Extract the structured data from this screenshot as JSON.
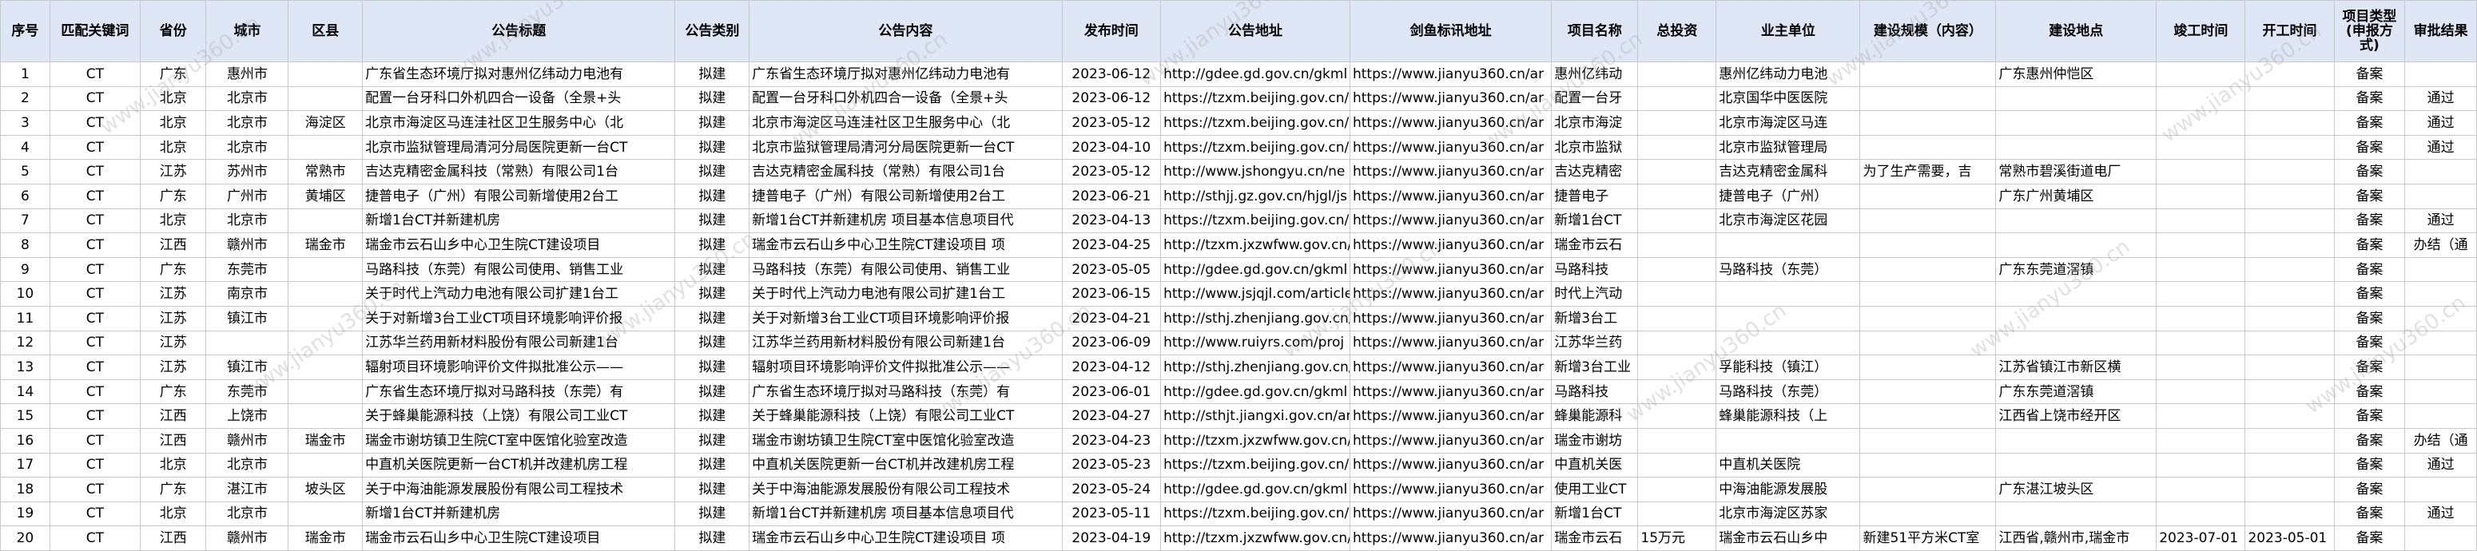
{
  "headers": [
    "序号",
    "匹配关键词",
    "省份",
    "城市",
    "区县",
    "公告标题",
    "公告类别",
    "公告内容",
    "发布时间",
    "公告地址",
    "剑鱼标讯地址",
    "项目名称",
    "总投资",
    "业主单位",
    "建设规模（内容）",
    "建设地点",
    "竣工时间",
    "开工时间",
    "项目类型(申报方式)",
    "审批结果"
  ],
  "rows": [
    [
      "1",
      "CT",
      "广东",
      "惠州市",
      "",
      "广东省生态环境厅拟对惠州亿纬动力电池有",
      "拟建",
      "广东省生态环境厅拟对惠州亿纬动力电池有",
      "2023-06-12",
      "http://gdee.gd.gov.cn/gkml",
      "https://www.jianyu360.cn/ar",
      "惠州亿纬动",
      "",
      "惠州亿纬动力电池",
      "",
      "广东惠州仲恺区",
      "",
      "",
      "备案",
      ""
    ],
    [
      "2",
      "CT",
      "北京",
      "北京市",
      "",
      "配置一台牙科口外机四合一设备（全景+头",
      "拟建",
      "配置一台牙科口外机四合一设备（全景+头",
      "2023-06-12",
      "https://tzxm.beijing.gov.cn/i",
      "https://www.jianyu360.cn/ar",
      "配置一台牙",
      "",
      "北京国华中医医院",
      "",
      "",
      "",
      "",
      "备案",
      "通过"
    ],
    [
      "3",
      "CT",
      "北京",
      "北京市",
      "海淀区",
      "北京市海淀区马连洼社区卫生服务中心（北",
      "拟建",
      "北京市海淀区马连洼社区卫生服务中心（北",
      "2023-05-12",
      "https://tzxm.beijing.gov.cn/i",
      "https://www.jianyu360.cn/ar",
      "北京市海淀",
      "",
      "北京市海淀区马连",
      "",
      "",
      "",
      "",
      "备案",
      "通过"
    ],
    [
      "4",
      "CT",
      "北京",
      "北京市",
      "",
      "北京市监狱管理局清河分局医院更新一台CT",
      "拟建",
      "北京市监狱管理局清河分局医院更新一台CT",
      "2023-04-10",
      "https://tzxm.beijing.gov.cn/i",
      "https://www.jianyu360.cn/ar",
      "北京市监狱",
      "",
      "北京市监狱管理局",
      "",
      "",
      "",
      "",
      "备案",
      "通过"
    ],
    [
      "5",
      "CT",
      "江苏",
      "苏州市",
      "常熟市",
      "吉达克精密金属科技（常熟）有限公司1台",
      "拟建",
      "吉达克精密金属科技（常熟）有限公司1台",
      "2023-05-12",
      "http://www.jshongyu.cn/ne",
      "https://www.jianyu360.cn/ar",
      "吉达克精密",
      "",
      "吉达克精密金属科",
      "为了生产需要，吉",
      "常熟市碧溪街道电厂",
      "",
      "",
      "备案",
      ""
    ],
    [
      "6",
      "CT",
      "广东",
      "广州市",
      "黄埔区",
      "捷普电子（广州）有限公司新增使用2台工",
      "拟建",
      "捷普电子（广州）有限公司新增使用2台工",
      "2023-06-21",
      "http://sthjj.gz.gov.cn/hjgl/js",
      "https://www.jianyu360.cn/ar",
      "捷普电子",
      "",
      "捷普电子（广州）",
      "",
      "广东广州黄埔区",
      "",
      "",
      "备案",
      ""
    ],
    [
      "7",
      "CT",
      "北京",
      "北京市",
      "",
      "新增1台CT并新建机房",
      "拟建",
      "新增1台CT并新建机房 项目基本信息项目代",
      "2023-04-13",
      "https://tzxm.beijing.gov.cn/i",
      "https://www.jianyu360.cn/ar",
      "新增1台CT",
      "",
      "北京市海淀区花园",
      "",
      "",
      "",
      "",
      "备案",
      "通过"
    ],
    [
      "8",
      "CT",
      "江西",
      "赣州市",
      "瑞金市",
      "瑞金市云石山乡中心卫生院CT建设项目",
      "拟建",
      "瑞金市云石山乡中心卫生院CT建设项目 项",
      "2023-04-25",
      "http://tzxm.jxzwfww.gov.cn/",
      "https://www.jianyu360.cn/ar",
      "瑞金市云石",
      "",
      "",
      "",
      "",
      "",
      "",
      "备案",
      "办结（通"
    ],
    [
      "9",
      "CT",
      "广东",
      "东莞市",
      "",
      "马路科技（东莞）有限公司使用、销售工业",
      "拟建",
      "马路科技（东莞）有限公司使用、销售工业",
      "2023-05-05",
      "http://gdee.gd.gov.cn/gkml",
      "https://www.jianyu360.cn/ar",
      "马路科技",
      "",
      "马路科技（东莞）",
      "",
      "广东东莞道滘镇",
      "",
      "",
      "备案",
      ""
    ],
    [
      "10",
      "CT",
      "江苏",
      "南京市",
      "",
      "关于时代上汽动力电池有限公司扩建1台工",
      "拟建",
      "关于时代上汽动力电池有限公司扩建1台工",
      "2023-06-15",
      "http://www.jsjqjl.com/article",
      "https://www.jianyu360.cn/ar",
      "时代上汽动",
      "",
      "",
      "",
      "",
      "",
      "",
      "备案",
      ""
    ],
    [
      "11",
      "CT",
      "江苏",
      "镇江市",
      "",
      "关于对新增3台工业CT项目环境影响评价报",
      "拟建",
      "关于对新增3台工业CT项目环境影响评价报",
      "2023-04-21",
      "http://sthj.zhenjiang.gov.cn/",
      "https://www.jianyu360.cn/ar",
      "新增3台工",
      "",
      "",
      "",
      "",
      "",
      "",
      "备案",
      ""
    ],
    [
      "12",
      "CT",
      "江苏",
      "",
      "",
      "江苏华兰药用新材料股份有限公司新建1台",
      "拟建",
      "江苏华兰药用新材料股份有限公司新建1台",
      "2023-06-09",
      "http://www.ruiyrs.com/proj",
      "https://www.jianyu360.cn/ar",
      "江苏华兰药",
      "",
      "",
      "",
      "",
      "",
      "",
      "备案",
      ""
    ],
    [
      "13",
      "CT",
      "江苏",
      "镇江市",
      "",
      "辐射项目环境影响评价文件拟批准公示——",
      "拟建",
      "辐射项目环境影响评价文件拟批准公示——",
      "2023-04-12",
      "http://sthj.zhenjiang.gov.cn/",
      "https://www.jianyu360.cn/ar",
      "新增3台工业",
      "",
      "孚能科技（镇江）",
      "",
      "江苏省镇江市新区横",
      "",
      "",
      "备案",
      ""
    ],
    [
      "14",
      "CT",
      "广东",
      "东莞市",
      "",
      "广东省生态环境厅拟对马路科技（东莞）有",
      "拟建",
      "广东省生态环境厅拟对马路科技（东莞）有",
      "2023-06-01",
      "http://gdee.gd.gov.cn/gkml",
      "https://www.jianyu360.cn/ar",
      "马路科技",
      "",
      "马路科技（东莞）",
      "",
      "广东东莞道滘镇",
      "",
      "",
      "备案",
      ""
    ],
    [
      "15",
      "CT",
      "江西",
      "上饶市",
      "",
      "关于蜂巢能源科技（上饶）有限公司工业CT",
      "拟建",
      "关于蜂巢能源科技（上饶）有限公司工业CT",
      "2023-04-27",
      "http://sthjt.jiangxi.gov.cn/ar",
      "https://www.jianyu360.cn/ar",
      "蜂巢能源科",
      "",
      "蜂巢能源科技（上",
      "",
      "江西省上饶市经开区",
      "",
      "",
      "备案",
      ""
    ],
    [
      "16",
      "CT",
      "江西",
      "赣州市",
      "瑞金市",
      "瑞金市谢坊镇卫生院CT室中医馆化验室改造",
      "拟建",
      "瑞金市谢坊镇卫生院CT室中医馆化验室改造",
      "2023-04-23",
      "http://tzxm.jxzwfww.gov.cn/",
      "https://www.jianyu360.cn/ar",
      "瑞金市谢坊",
      "",
      "",
      "",
      "",
      "",
      "",
      "备案",
      "办结（通"
    ],
    [
      "17",
      "CT",
      "北京",
      "北京市",
      "",
      "中直机关医院更新一台CT机并改建机房工程",
      "拟建",
      "中直机关医院更新一台CT机并改建机房工程",
      "2023-05-23",
      "https://tzxm.beijing.gov.cn/i",
      "https://www.jianyu360.cn/ar",
      "中直机关医",
      "",
      "中直机关医院",
      "",
      "",
      "",
      "",
      "备案",
      "通过"
    ],
    [
      "18",
      "CT",
      "广东",
      "湛江市",
      "坡头区",
      "关于中海油能源发展股份有限公司工程技术",
      "拟建",
      "关于中海油能源发展股份有限公司工程技术",
      "2023-05-24",
      "http://gdee.gd.gov.cn/gkml",
      "https://www.jianyu360.cn/ar",
      "使用工业CT",
      "",
      "中海油能源发展股",
      "",
      "广东湛江坡头区",
      "",
      "",
      "备案",
      ""
    ],
    [
      "19",
      "CT",
      "北京",
      "北京市",
      "",
      "新增1台CT并新建机房",
      "拟建",
      "新增1台CT并新建机房 项目基本信息项目代",
      "2023-05-11",
      "https://tzxm.beijing.gov.cn/i",
      "https://www.jianyu360.cn/ar",
      "新增1台CT",
      "",
      "北京市海淀区苏家",
      "",
      "",
      "",
      "",
      "备案",
      "通过"
    ],
    [
      "20",
      "CT",
      "江西",
      "赣州市",
      "瑞金市",
      "瑞金市云石山乡中心卫生院CT建设项目",
      "拟建",
      "瑞金市云石山乡中心卫生院CT建设项目 项",
      "2023-04-19",
      "http://tzxm.jxzwfww.gov.cn/",
      "https://www.jianyu360.cn/ar",
      "瑞金市云石",
      "15万元",
      "瑞金市云石山乡中",
      "新建51平方米CT室",
      "江西省,赣州市,瑞金市",
      "2023-07-01",
      "2023-05-01",
      "备案",
      ""
    ]
  ],
  "watermark_text": "www.jianyu360.cn"
}
